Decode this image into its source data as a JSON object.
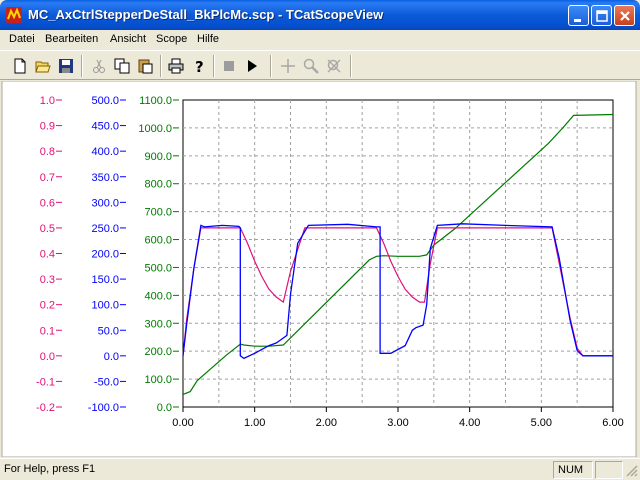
{
  "window": {
    "title": "MC_AxCtrlStepperDeStall_BkPlcMc.scp - TCatScopeView"
  },
  "menu": {
    "items": [
      "Datei",
      "Bearbeiten",
      "Ansicht",
      "Scope",
      "Hilfe"
    ]
  },
  "toolbar": {
    "icons": [
      "new-icon",
      "open-icon",
      "save-icon",
      "cut-icon",
      "copy-icon",
      "paste-icon",
      "print-icon",
      "help-icon",
      "stop-icon",
      "run-icon",
      "crosshair-icon",
      "zoom-icon",
      "zoom-reset-icon"
    ]
  },
  "statusbar": {
    "text": "For Help, press F1",
    "num": "NUM"
  },
  "colors": {
    "pink": "#E0107A",
    "blue": "#0000FF",
    "green": "#007A00",
    "grid": "#A0A0A0"
  },
  "chart_data": {
    "type": "line",
    "title": "",
    "x_ticks": [
      "0.00",
      "1.00",
      "2.00",
      "3.00",
      "4.00",
      "5.00",
      "6.00"
    ],
    "xlim": [
      0,
      6
    ],
    "axes": [
      {
        "color": "pink",
        "ylim": [
          -0.2,
          1.0
        ],
        "ticks": [
          "1.0",
          "0.9",
          "0.8",
          "0.7",
          "0.6",
          "0.5",
          "0.4",
          "0.3",
          "0.2",
          "0.1",
          "0.0",
          "-0.1",
          "-0.2"
        ]
      },
      {
        "color": "blue",
        "ylim": [
          -100,
          500
        ],
        "ticks": [
          "500.0",
          "450.0",
          "400.0",
          "350.0",
          "300.0",
          "250.0",
          "200.0",
          "150.0",
          "100.0",
          "50.0",
          "0.0",
          "-50.0",
          "-100.0"
        ]
      },
      {
        "color": "green",
        "ylim": [
          0,
          1100
        ],
        "ticks": [
          "1100.0",
          "1000.0",
          "900.0",
          "800.0",
          "700.0",
          "600.0",
          "500.0",
          "400.0",
          "300.0",
          "200.0",
          "100.0",
          "0.0"
        ]
      }
    ],
    "series": [
      {
        "color": "green",
        "axis": 2,
        "x": [
          0.0,
          0.1,
          0.2,
          0.4,
          0.6,
          0.8,
          0.85,
          1.0,
          1.2,
          1.4,
          2.6,
          2.7,
          2.8,
          3.0,
          3.3,
          3.4,
          3.5,
          3.8,
          5.1,
          5.3,
          5.45,
          6.0
        ],
        "y": [
          45,
          55,
          95,
          140,
          185,
          225,
          222,
          218,
          218,
          222,
          527,
          540,
          542,
          540,
          540,
          545,
          580,
          640,
          945,
          1000,
          1045,
          1048
        ]
      },
      {
        "color": "pink",
        "axis": 0,
        "x": [
          0.0,
          0.05,
          0.15,
          0.25,
          0.3,
          0.8,
          0.9,
          1.0,
          1.1,
          1.2,
          1.3,
          1.4,
          1.5,
          1.7,
          2.7,
          2.8,
          2.9,
          3.0,
          3.1,
          3.2,
          3.3,
          3.37,
          3.45,
          3.55,
          5.15,
          5.25,
          5.4,
          5.5,
          5.58,
          6.0
        ],
        "y": [
          0.0,
          0.14,
          0.34,
          0.5,
          0.5,
          0.5,
          0.44,
          0.37,
          0.31,
          0.26,
          0.23,
          0.21,
          0.33,
          0.5,
          0.5,
          0.44,
          0.37,
          0.31,
          0.26,
          0.23,
          0.21,
          0.21,
          0.36,
          0.5,
          0.5,
          0.36,
          0.15,
          0.03,
          0.0,
          0.0
        ]
      },
      {
        "color": "blue",
        "axis": 1,
        "x": [
          0.0,
          0.05,
          0.15,
          0.25,
          0.3,
          0.55,
          0.78,
          0.8,
          0.8,
          0.85,
          1.0,
          1.2,
          1.3,
          1.35,
          1.45,
          1.5,
          1.6,
          1.75,
          2.3,
          2.7,
          2.75,
          2.75,
          2.9,
          3.1,
          3.2,
          3.25,
          3.35,
          3.4,
          3.45,
          3.55,
          3.9,
          4.5,
          5.15,
          5.25,
          5.4,
          5.5,
          5.58,
          6.0
        ],
        "y": [
          0,
          60,
          170,
          255,
          252,
          255,
          253,
          250,
          0,
          -5,
          5,
          20,
          25,
          30,
          40,
          120,
          220,
          255,
          257,
          252,
          252,
          5,
          5,
          20,
          50,
          55,
          60,
          100,
          210,
          255,
          258,
          255,
          252,
          190,
          70,
          10,
          0,
          0
        ]
      }
    ]
  }
}
